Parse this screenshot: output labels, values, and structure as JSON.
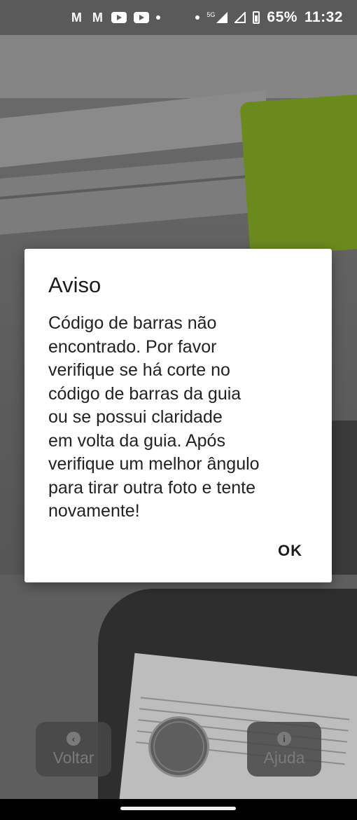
{
  "status_bar": {
    "notification_icons": [
      "gmail-icon",
      "gmail-icon",
      "youtube-icon",
      "youtube-icon",
      "dot-icon"
    ],
    "network_label": "5G",
    "battery_text": "65%",
    "time": "11:32"
  },
  "dialog": {
    "title": "Aviso",
    "message": "Código de barras não\nencontrado. Por favor\nverifique se há corte no\ncódigo de barras da guia\nou se possui claridade\nem volta da guia. Após\nverifique um melhor ângulo\npara tirar outra foto e tente\nnovamente!",
    "ok_label": "OK"
  },
  "camera_controls": {
    "back_label": "Voltar",
    "back_icon": "chevron-left-icon",
    "help_label": "Ajuda",
    "help_icon": "info-icon"
  },
  "colors": {
    "dialog_background": "#ffffff",
    "overlay": "#5a5a5a",
    "nav_bar": "#000000"
  }
}
